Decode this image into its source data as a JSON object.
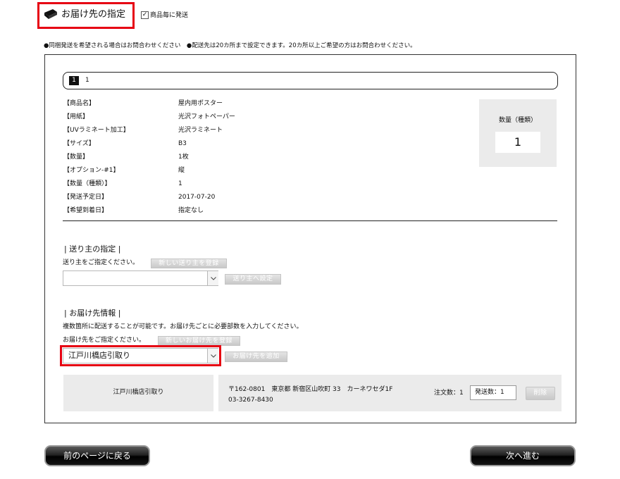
{
  "header": {
    "title": "お届け先の指定",
    "per_item_label": "商品毎に発送",
    "per_item_checked": true
  },
  "notice": "●同梱発送を希望される場合はお問合わせください　●配送先は20カ所まで設定できます。20カ所以上ご希望の方はお問合わせください。",
  "tabs": {
    "active": "1",
    "label": "1"
  },
  "specs": [
    {
      "label": "【商品名】",
      "value": "屋内用ポスター"
    },
    {
      "label": "【用紙】",
      "value": "光沢フォトペーパー"
    },
    {
      "label": "【UVラミネート加工】",
      "value": "光沢ラミネート"
    },
    {
      "label": "【サイズ】",
      "value": "B3"
    },
    {
      "label": "【数量】",
      "value": "1枚"
    },
    {
      "label": "【オプション-#1】",
      "value": "縦"
    },
    {
      "label": "【数量（種類）】",
      "value": "1"
    },
    {
      "label": "【発送予定日】",
      "value": "2017-07-20"
    },
    {
      "label": "【希望到着日】",
      "value": "指定なし"
    }
  ],
  "quantity_box": {
    "label": "数量（種類）",
    "value": "1"
  },
  "sender": {
    "heading": "| 送り主の指定 |",
    "instruction": "送り主をご指定ください。",
    "new_button": "新しい送り主を登録",
    "select_value": "",
    "set_button": "送り主へ設定"
  },
  "delivery": {
    "heading": "| お届け先情報 |",
    "multi_note": "複数箇所に配送することが可能です。お届け先ごとに必要部数を入力してください。",
    "instruction": "お届け先をご指定ください。",
    "new_button": "新しいお届け先を登録",
    "select_value": "江戸川橋店引取り",
    "add_button": "お届け先を追加"
  },
  "destination": {
    "name": "江戸川橋店引取り",
    "address": "〒162-0801　東京都 新宿区山吹町 33　カーネワセダ1F",
    "phone": "03-3267-8430",
    "order_qty": "注文数：1",
    "ship_qty": "発送数：1",
    "delete_button": "削除"
  },
  "nav": {
    "back": "前のページに戻る",
    "next": "次へ進む"
  },
  "colors": {
    "highlight": "#e60012",
    "panel": "#ebebeb"
  }
}
